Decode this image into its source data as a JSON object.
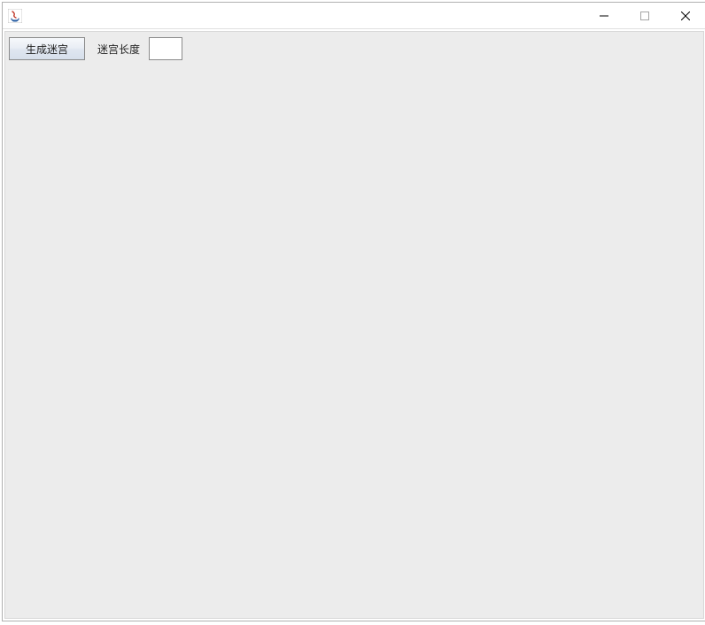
{
  "window": {
    "title": ""
  },
  "toolbar": {
    "generate_button_label": "生成迷宫",
    "length_label": "迷宫长度",
    "length_value": ""
  },
  "icons": {
    "app": "java-app-icon",
    "minimize": "minimize-icon",
    "maximize": "maximize-icon",
    "close": "close-icon"
  }
}
